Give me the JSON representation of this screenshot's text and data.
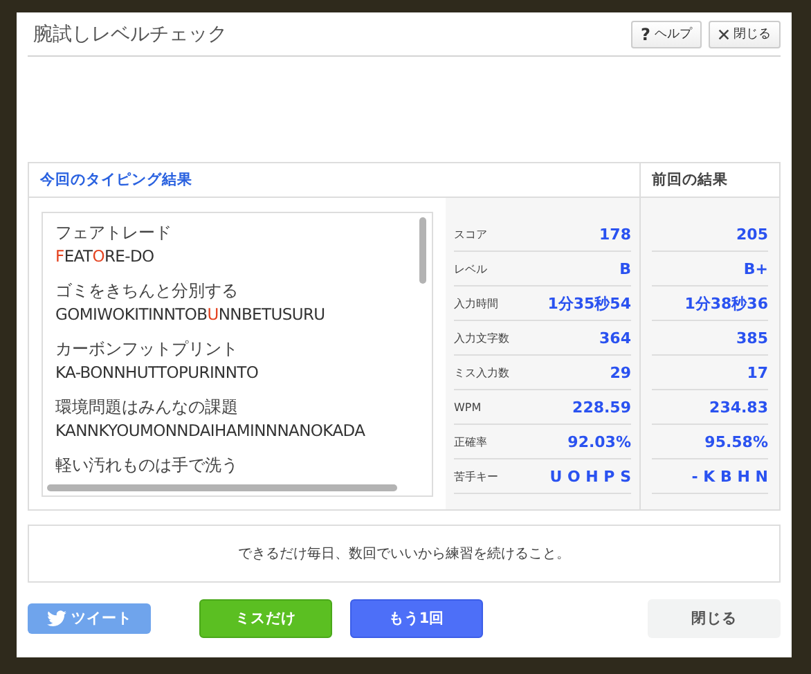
{
  "dialog": {
    "title": "腕試しレベルチェック",
    "help_button": "ヘルプ",
    "help_icon": "?",
    "close_button": "閉じる"
  },
  "results": {
    "current_heading": "今回のタイピング結果",
    "previous_heading": "前回の結果",
    "entries": [
      {
        "japanese": "フェアトレード",
        "romaji": [
          {
            "text": "F",
            "miss": true
          },
          {
            "text": "EAT",
            "miss": false
          },
          {
            "text": "O",
            "miss": true
          },
          {
            "text": "RE-DO",
            "miss": false
          }
        ]
      },
      {
        "japanese": "ゴミをきちんと分別する",
        "romaji": [
          {
            "text": "GOMIWOKITINNTOB",
            "miss": false
          },
          {
            "text": "U",
            "miss": true
          },
          {
            "text": "NNBETUSURU",
            "miss": false
          }
        ]
      },
      {
        "japanese": "カーボンフットプリント",
        "romaji": [
          {
            "text": "KA-BONNHUTTOPURINNTO",
            "miss": false
          }
        ]
      },
      {
        "japanese": "環境問題はみんなの課題",
        "romaji": [
          {
            "text": "KANNKYOUMONNDAIHAMINNNANOKADA",
            "miss": false
          }
        ]
      },
      {
        "japanese": "軽い汚れものは手で洗う"
      }
    ],
    "stats": [
      {
        "label": "スコア",
        "current": "178",
        "previous": "205"
      },
      {
        "label": "レベル",
        "current": "B",
        "previous": "B+"
      },
      {
        "label": "入力時間",
        "current": "1分35秒54",
        "previous": "1分38秒36"
      },
      {
        "label": "入力文字数",
        "current": "364",
        "previous": "385"
      },
      {
        "label": "ミス入力数",
        "current": "29",
        "previous": "17"
      },
      {
        "label": "WPM",
        "current": "228.59",
        "previous": "234.83"
      },
      {
        "label": "正確率",
        "current": "92.03%",
        "previous": "95.58%"
      },
      {
        "label": "苦手キー",
        "current": "U O H P S",
        "previous": "- K B H N"
      }
    ]
  },
  "advice": "できるだけ毎日、数回でいいから練習を続けること。",
  "buttons": [
    {
      "kind": "tweet",
      "label": "ツイート"
    },
    {
      "kind": "miss",
      "label": "ミスだけ"
    },
    {
      "kind": "retry",
      "label": "もう1回"
    },
    {
      "kind": "close",
      "label": "閉じる"
    }
  ]
}
